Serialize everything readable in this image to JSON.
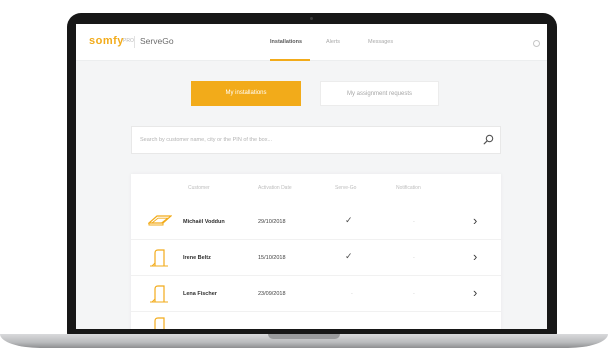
{
  "app": {
    "logo": "somfy",
    "logo_sub": "PRO",
    "product": "ServeGo"
  },
  "nav": {
    "items": [
      "Installations",
      "Alerts",
      "Messages"
    ],
    "active": "Installations"
  },
  "tabs": {
    "active": "My installations",
    "inactive": "My assignment requests"
  },
  "search": {
    "placeholder": "Search by customer name, city or the PIN of the box..."
  },
  "table": {
    "headers": [
      "Customer",
      "Activation Date",
      "Serve-Go",
      "Notification"
    ],
    "rows": [
      {
        "customer": "Michaël Voddun",
        "date": "29/10/2018",
        "servego": "✓",
        "notification": "-",
        "icon": "roof-window-icon"
      },
      {
        "customer": "Irene Beltz",
        "date": "15/10/2018",
        "servego": "✓",
        "notification": "-",
        "icon": "door-icon"
      },
      {
        "customer": "Lena Fischer",
        "date": "23/09/2018",
        "servego": "-",
        "notification": "-",
        "icon": "door-icon"
      }
    ]
  },
  "colors": {
    "accent": "#f2ab1a",
    "bezel": "#171717",
    "screen_bg": "#f4f5f6"
  }
}
